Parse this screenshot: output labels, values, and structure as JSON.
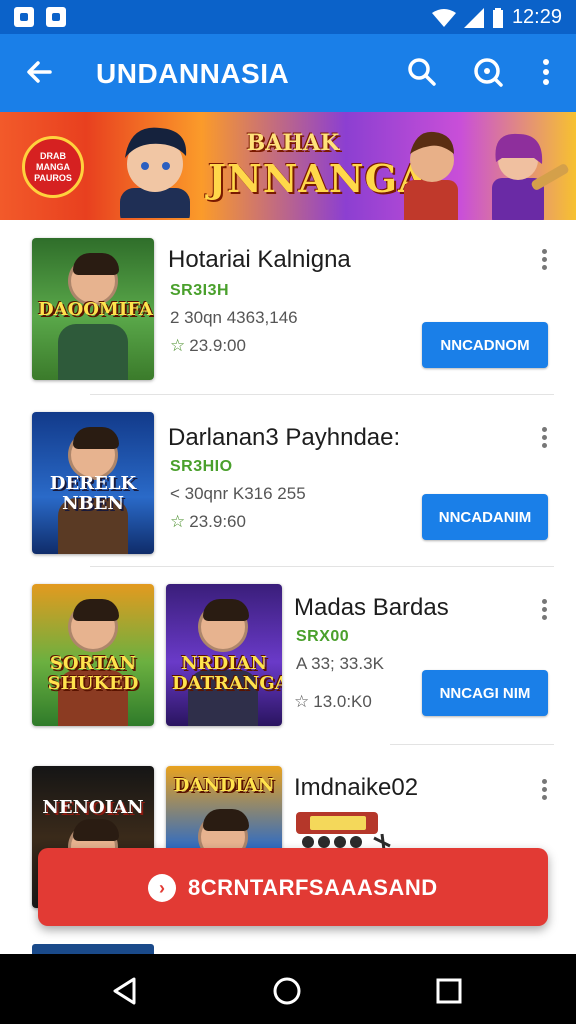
{
  "status_bar": {
    "time": "12:29"
  },
  "app_bar": {
    "title": "UNDANNASIA"
  },
  "banner": {
    "badge_text": "DRAB\nMANGA\nPAUROS",
    "title_line1": "BAHAK",
    "title_line2": "JNNANGA"
  },
  "apps": [
    {
      "name": "Hotariai Kalnigna",
      "price": "SR3I3H",
      "meta": "2 30qn 4363,146",
      "rating": "23.9:00",
      "button": "NNCADNOM",
      "thumb_title": "DAOOMIFA"
    },
    {
      "name": "Darlanan3 Payhndae:",
      "price": "SR3HIO",
      "meta": "< 30qnr K316 255",
      "rating": "23.9:60",
      "button": "NNCADANIM",
      "thumb_title": "DERELK NBEN"
    },
    {
      "name": "Madas Bardas",
      "price": "SRX00",
      "meta": "A 33; 33.3K",
      "rating": "13.0:K0",
      "button": "NNCAGI NIM",
      "thumb_title": "SORTAN SHUKED",
      "thumb2_title": "NRDIAN DATRANGA"
    },
    {
      "name": "Imdnaike02",
      "price": "",
      "meta": "",
      "rating": "",
      "button": "",
      "thumb_title": "NENOIAN",
      "thumb2_title": "DANDIAN"
    }
  ],
  "floating_button": {
    "label": "8CRNTARFSAAASAND"
  },
  "colors": {
    "primary": "#1a7fe8",
    "status": "#0b62c9",
    "accent": "#e23a34",
    "price": "#4aa02c"
  }
}
